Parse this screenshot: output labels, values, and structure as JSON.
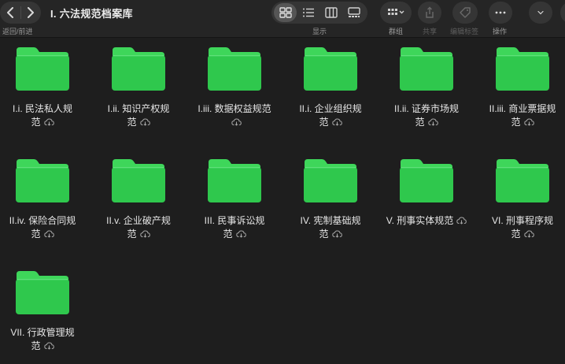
{
  "toolbar": {
    "nav_label": "返回/前进",
    "title": "I. 六法规范档案库",
    "view_label": "显示",
    "group_label": "群组",
    "share_label": "共享",
    "tags_label": "编辑标签",
    "action_label": "操作"
  },
  "folders": [
    {
      "line1": "I.i. 民法私人规",
      "line2": "范"
    },
    {
      "line1": "I.ii. 知识产权规",
      "line2": "范"
    },
    {
      "line1": "I.iii. 数据权益规范",
      "line2": ""
    },
    {
      "line1": "II.i. 企业组织规",
      "line2": "范"
    },
    {
      "line1": "II.ii. 证券市场规",
      "line2": "范"
    },
    {
      "line1": "II.iii. 商业票据规",
      "line2": "范"
    },
    {
      "line1": "II.iv. 保险合同规",
      "line2": "范"
    },
    {
      "line1": "II.v. 企业破产规",
      "line2": "范"
    },
    {
      "line1": "III. 民事诉讼规",
      "line2": "范"
    },
    {
      "line1": "IV. 宪制基础规",
      "line2": "范"
    },
    {
      "line1": "V. 刑事实体规范",
      "line2": ""
    },
    {
      "line1": "VI. 刑事程序规",
      "line2": "范"
    },
    {
      "line1": "VII. 行政管理规",
      "line2": "范"
    }
  ],
  "colors": {
    "folder_green": "#2fc84d",
    "folder_tab": "#3ed65a",
    "background": "#1e1e1e"
  }
}
